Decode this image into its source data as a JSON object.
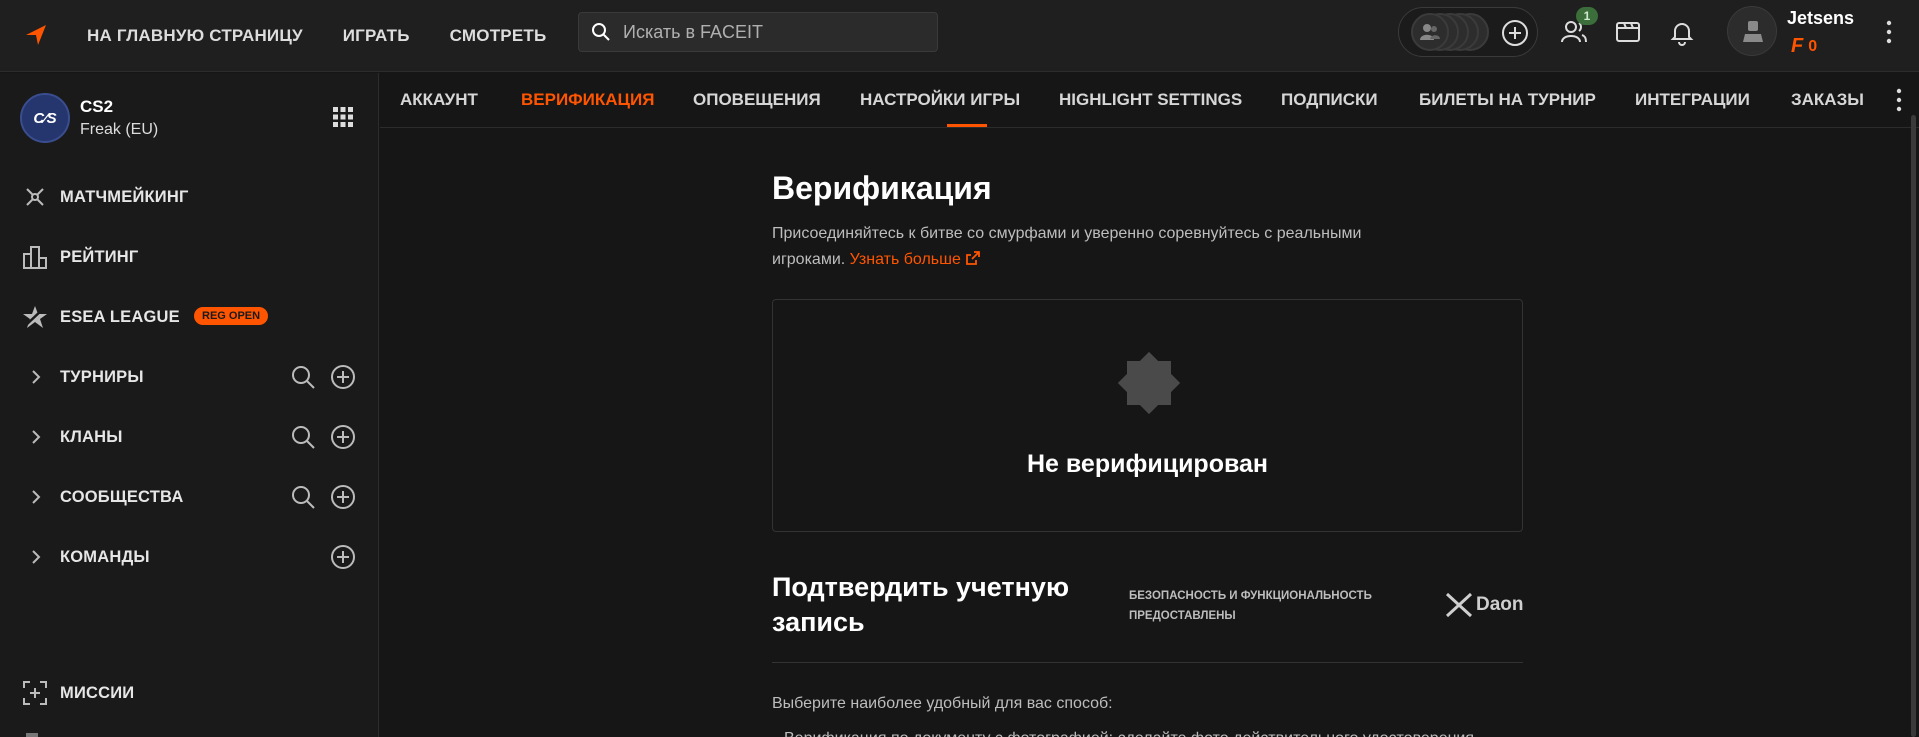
{
  "topbar": {
    "nav": [
      "НА ГЛАВНУЮ СТРАНИЦУ",
      "ИГРАТЬ",
      "СМОТРЕТЬ"
    ],
    "search_placeholder": "Искать в FACEIT",
    "friends_badge": "1",
    "username": "Jetsens",
    "points": "0",
    "icons": [
      "faceit-logo-icon",
      "search-icon",
      "party-slots",
      "add-icon",
      "friends-icon",
      "watch-icon",
      "bell-icon",
      "avatar",
      "kebab-icon"
    ]
  },
  "sidebar": {
    "game_logo_text": "C⁄S",
    "game_name": "CS2",
    "game_region": "Freak (EU)",
    "items": [
      {
        "label": "МАТЧМЕЙКИНГ",
        "icon": "matchmaking-icon"
      },
      {
        "label": "РЕЙТИНГ",
        "icon": "ranking-icon"
      },
      {
        "label": "ESEA LEAGUE",
        "icon": "esea-icon",
        "badge": "REG OPEN"
      },
      {
        "label": "ТУРНИРЫ",
        "icon": "chevron-right-icon",
        "actions": [
          "search",
          "add"
        ]
      },
      {
        "label": "КЛАНЫ",
        "icon": "chevron-right-icon",
        "actions": [
          "search",
          "add"
        ]
      },
      {
        "label": "СООБЩЕСТВА",
        "icon": "chevron-right-icon",
        "actions": [
          "search",
          "add"
        ]
      },
      {
        "label": "КОМАНДЫ",
        "icon": "chevron-right-icon",
        "actions": [
          "add"
        ]
      },
      {
        "label": "МИССИИ",
        "icon": "missions-icon"
      }
    ]
  },
  "tabs": [
    "АККАУНТ",
    "ВЕРИФИКАЦИЯ",
    "ОПОВЕЩЕНИЯ",
    "НАСТРОЙКИ ИГРЫ",
    "HIGHLIGHT SETTINGS",
    "ПОДПИСКИ",
    "БИЛЕТЫ НА ТУРНИР",
    "ИНТЕГРАЦИИ",
    "ЗАКАЗЫ"
  ],
  "active_tab": "ВЕРИФИКАЦИЯ",
  "accent_color": "#ff5500",
  "main": {
    "title": "Верификация",
    "description_line1": "Присоединяйтесь к битве со смурфами и уверенно соревнуйтесь с реальными",
    "description_line2": "игроками.",
    "learn_more": "Узнать больше",
    "status": "Не верифицирован",
    "confirm_title": "Подтвердить учетную запись",
    "security_note": "БЕЗОПАСНОСТЬ И ФУНКЦИОНАЛЬНОСТЬ ПРЕДОСТАВЛЕНЫ",
    "provider": "Daon",
    "choose_method": "Выберите наиболее удобный для вас способ:",
    "partial_line": "Верификация по документу с фотографией: сделайте фото действительного удостоверения"
  }
}
